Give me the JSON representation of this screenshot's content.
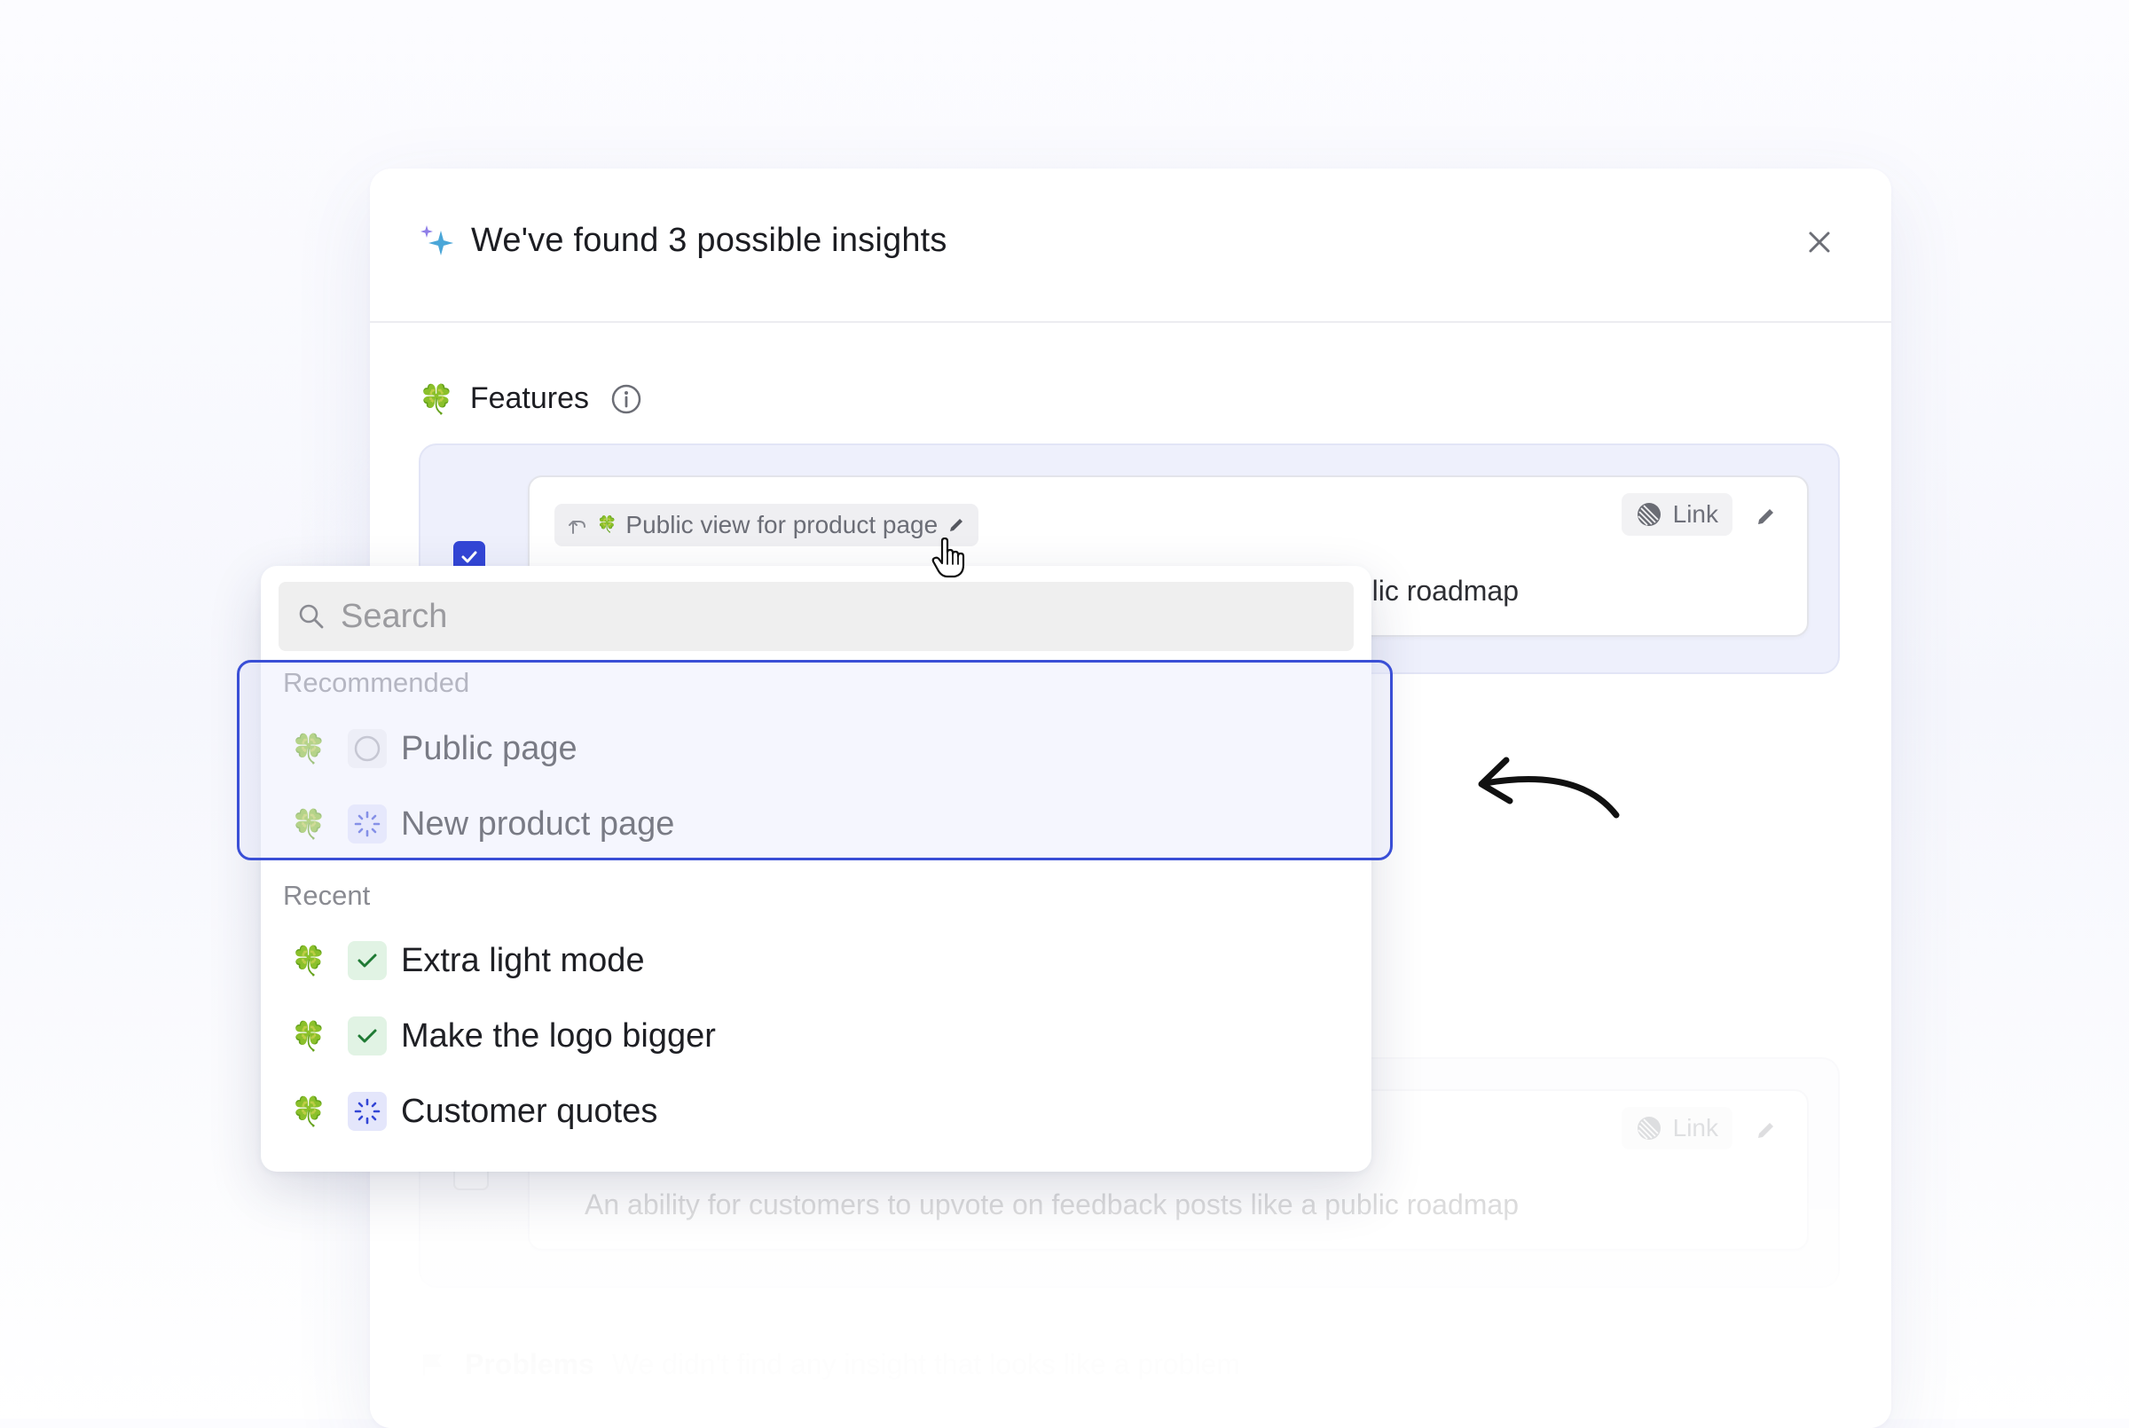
{
  "modal": {
    "title": "We've found 3 possible insights",
    "sections": {
      "features": {
        "title": "Features",
        "insight": {
          "checked": true,
          "chip_label": "Public view for product page",
          "link_label": "Link",
          "description": "An ability for customers to upvote on feedback posts like a public roadmap"
        },
        "insight2": {
          "checked": false,
          "link_label": "Link",
          "description": "An ability for customers to upvote on feedback posts like a public roadmap"
        }
      },
      "problems": {
        "title": "Problems",
        "message": "We didn't find any insight that looks like a problem"
      }
    }
  },
  "dropdown": {
    "search_placeholder": "Search",
    "groups": {
      "recommended": {
        "label": "Recommended",
        "items": [
          {
            "label": "Public page",
            "status": "todo"
          },
          {
            "label": "New product page",
            "status": "in-progress"
          }
        ]
      },
      "recent": {
        "label": "Recent",
        "items": [
          {
            "label": "Extra light mode",
            "status": "done"
          },
          {
            "label": "Make the logo bigger",
            "status": "done"
          },
          {
            "label": "Customer quotes",
            "status": "in-progress"
          }
        ]
      }
    }
  },
  "icons": {
    "feature": "clover-icon",
    "glyph": "🍀",
    "sparkle": "sparkle-icon",
    "close": "close-icon",
    "info": "info-icon",
    "search": "search-icon",
    "link": "linear-icon",
    "edit": "pencil-icon",
    "parent": "corner-up-left-icon"
  },
  "colors": {
    "accent": "#3a4fd6",
    "checkbox": "#3346d6",
    "done": "#1f7a34",
    "in_progress": "#3346d6",
    "clover": "#3c9a38"
  }
}
